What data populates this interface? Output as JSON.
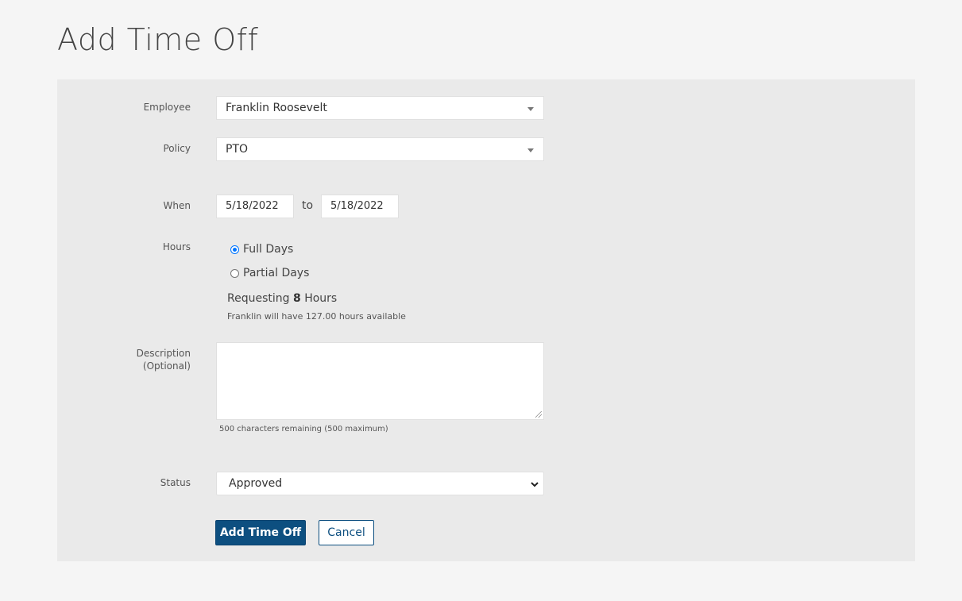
{
  "page": {
    "title": "Add Time Off"
  },
  "form": {
    "employee": {
      "label": "Employee",
      "value": "Franklin Roosevelt"
    },
    "policy": {
      "label": "Policy",
      "value": "PTO"
    },
    "when": {
      "label": "When",
      "start": "5/18/2022",
      "separator": "to",
      "end": "5/18/2022"
    },
    "hours": {
      "label": "Hours",
      "options": [
        {
          "label": "Full Days",
          "checked": true
        },
        {
          "label": "Partial Days",
          "checked": false
        }
      ],
      "requesting_prefix": "Requesting",
      "requesting_amount": "8",
      "requesting_suffix": "Hours",
      "available_text": "Franklin will have 127.00 hours available"
    },
    "description": {
      "label_line1": "Description",
      "label_line2": "(Optional)",
      "value": "",
      "char_count_text": "500 characters remaining (500 maximum)"
    },
    "status": {
      "label": "Status",
      "value": "Approved"
    },
    "actions": {
      "submit_label": "Add Time Off",
      "cancel_label": "Cancel"
    }
  },
  "colors": {
    "primary": "#0d4f80",
    "page_bg": "#f5f5f5",
    "panel_bg": "#eaeaea",
    "radio_accent": "#0075ff"
  }
}
